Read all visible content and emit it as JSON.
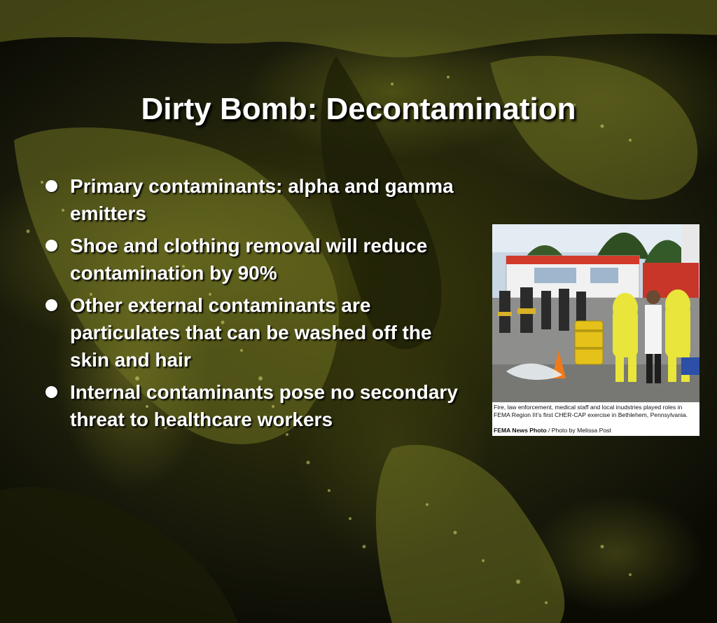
{
  "slide": {
    "title": "Dirty Bomb: Decontamination",
    "bullets": [
      {
        "text": "Primary contaminants: alpha and gamma emitters"
      },
      {
        "text": "Shoe and clothing removal will reduce contamination by 90%"
      },
      {
        "text": "Other external contaminants are particulates that can be washed off the skin and hair"
      },
      {
        "text": "Internal contaminants pose no secondary threat to healthcare workers"
      }
    ]
  },
  "photo": {
    "caption": "Fire, law enforcement, medical staff and local inudstries played roles in FEMA Region III's first CHER-CAP exercise in Bethlehem, Pennsylvania.",
    "credit_source": "FEMA News Photo",
    "credit_separator": " / ",
    "credit_author": "Photo by Melissa Post"
  },
  "colors": {
    "text": "#ffffff",
    "background": "#2a2b08",
    "map_lights": "#c8c85a"
  },
  "icons": {
    "bullet": "filled-circle"
  }
}
